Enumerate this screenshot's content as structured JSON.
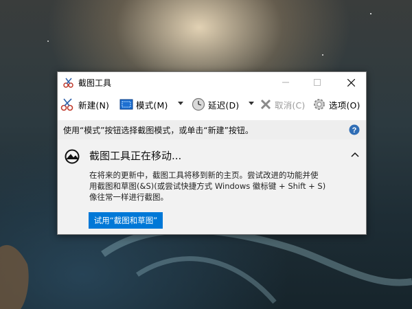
{
  "window": {
    "title": "截图工具"
  },
  "toolbar": {
    "new_label": "新建(N)",
    "mode_label": "模式(M)",
    "delay_label": "延迟(D)",
    "cancel_label": "取消(C)",
    "options_label": "选项(O)"
  },
  "hint": {
    "text": "使用“模式”按钮选择截图模式，或单击“新建”按钮。"
  },
  "notice": {
    "title": "截图工具正在移动...",
    "body_lines": [
      "在将来的更新中，截图工具将移到新的主页。尝试改进的功能并使",
      "用截图和草图(&S)(或尝试快捷方式 Windows 徽标键 + Shift + S)",
      "像往常一样进行截图。"
    ],
    "button_label": "试用“截图和草图”"
  },
  "colors": {
    "accent": "#0078d7",
    "hint_bg": "#eeeeee",
    "notice_bg": "#f2f2f2"
  }
}
